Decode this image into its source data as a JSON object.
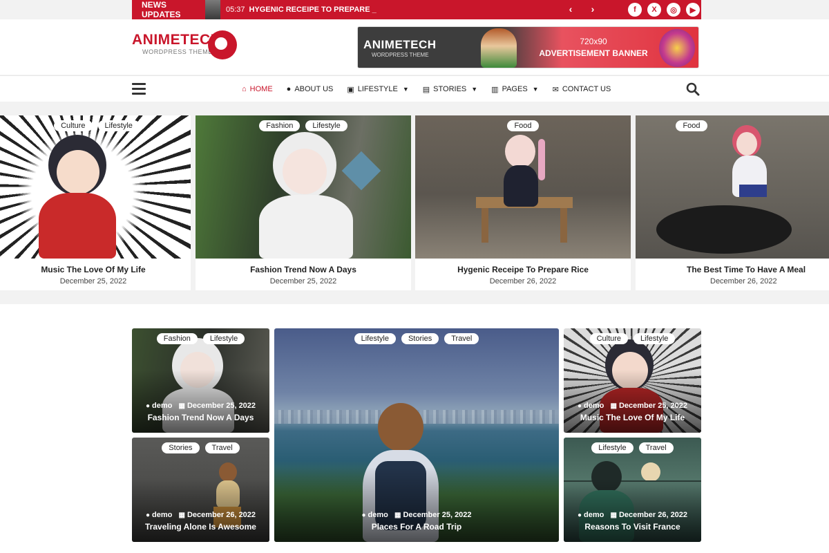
{
  "topbar": {
    "label": "NEWS UPDATES",
    "time": "05:37",
    "headline": "HYGENIC RECEIPE TO PREPARE _",
    "prev": "‹",
    "next": "›",
    "socials": [
      "f",
      "X",
      "◎",
      "▶"
    ]
  },
  "header": {
    "logo_title": "ANIMETECH",
    "logo_sub": "WORDPRESS THEME",
    "ad_logo_title": "ANIMETECH",
    "ad_logo_sub": "WORDPRESS THEME",
    "ad_size": "720x90",
    "ad_title": "ADVERTISEMENT BANNER"
  },
  "nav": {
    "items": [
      {
        "label": "HOME",
        "icon": "⌂"
      },
      {
        "label": "ABOUT US",
        "icon": "●"
      },
      {
        "label": "LIFESTYLE",
        "icon": "▣",
        "caret": "▼"
      },
      {
        "label": "STORIES",
        "icon": "▤",
        "caret": "▼"
      },
      {
        "label": "PAGES",
        "icon": "▥",
        "caret": "▼"
      },
      {
        "label": "CONTACT US",
        "icon": "✉"
      }
    ]
  },
  "slider": [
    {
      "tags": [
        "Culture",
        "Lifestyle"
      ],
      "title": "Music The Love Of My Life",
      "date": "December 25, 2022"
    },
    {
      "tags": [
        "Fashion",
        "Lifestyle"
      ],
      "title": "Fashion Trend Now A Days",
      "date": "December 25, 2022"
    },
    {
      "tags": [
        "Food"
      ],
      "title": "Hygenic Receipe To Prepare Rice",
      "date": "December 26, 2022"
    },
    {
      "tags": [
        "Food"
      ],
      "title": "The Best Time To Have A Meal",
      "date": "December 26, 2022"
    }
  ],
  "grid": [
    {
      "tags": [
        "Fashion",
        "Lifestyle"
      ],
      "author": "demo",
      "date": "December 25, 2022",
      "title": "Fashion Trend Now A Days"
    },
    {
      "tags": [
        "Lifestyle",
        "Stories",
        "Travel"
      ],
      "author": "demo",
      "date": "December 25, 2022",
      "title": "Places For A Road Trip"
    },
    {
      "tags": [
        "Culture",
        "Lifestyle"
      ],
      "author": "demo",
      "date": "December 25, 2022",
      "title": "Music The Love Of My Life"
    },
    {
      "tags": [
        "Stories",
        "Travel"
      ],
      "author": "demo",
      "date": "December 26, 2022",
      "title": "Traveling Alone Is Awesome"
    },
    {
      "tags": [
        "Lifestyle",
        "Travel"
      ],
      "author": "demo",
      "date": "December 26, 2022",
      "title": "Reasons To Visit France"
    }
  ],
  "colors": {
    "brand": "#c9162b"
  }
}
